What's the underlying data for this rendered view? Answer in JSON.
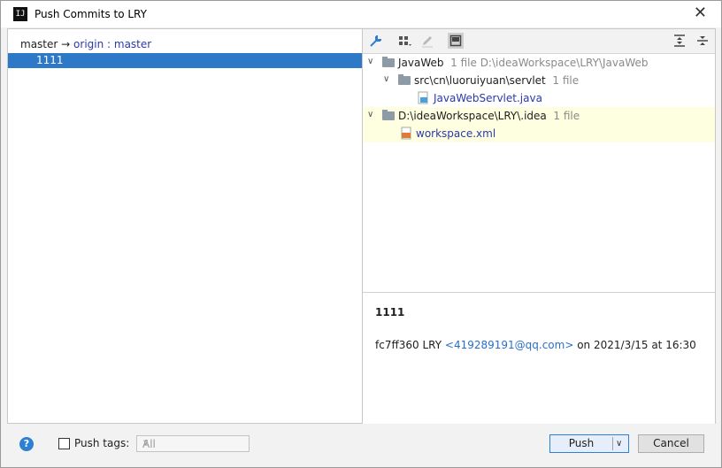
{
  "window": {
    "title": "Push Commits to LRY",
    "app_icon": "IJ"
  },
  "left_panel": {
    "branch": {
      "local": "master",
      "arrow": "→",
      "remote": "origin",
      "sep": " : ",
      "remote_branch": "master"
    },
    "commits": [
      {
        "label": "1111"
      }
    ]
  },
  "toolbar": {
    "icons": [
      "collapse-icon",
      "group-by-icon",
      "edit-icon",
      "preview-icon",
      "expand-all-icon",
      "collapse-all-icon"
    ]
  },
  "tree": [
    {
      "name": "JavaWeb",
      "meta": "1 file  D:\\ideaWorkspace\\LRY\\JavaWeb"
    },
    {
      "name": "src\\cn\\luoruiyuan\\servlet",
      "meta": "1 file"
    },
    {
      "name": "JavaWebServlet.java",
      "meta": ""
    },
    {
      "name": "D:\\ideaWorkspace\\LRY\\.idea",
      "meta": "1 file"
    },
    {
      "name": "workspace.xml",
      "meta": ""
    }
  ],
  "details": {
    "title": "1111",
    "hash": "fc7ff360",
    "author": "LRY",
    "email": "<419289191@qq.com>",
    "date": "on 2021/3/15 at 16:30"
  },
  "bottom": {
    "help": "?",
    "push_tags_label": "Push tags:",
    "tags_select": "All",
    "push_label": "Push",
    "cancel_label": "Cancel"
  },
  "colors": {
    "selection": "#2e78c8",
    "accent": "#2f7fd2",
    "highlight_row": "#fefee0"
  }
}
